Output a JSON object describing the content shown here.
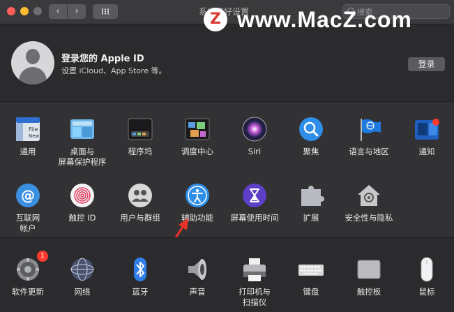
{
  "window": {
    "title": "系统偏好设置",
    "search_placeholder": "搜索"
  },
  "watermark": {
    "logo_letter": "Z",
    "text": "www.MacZ.com"
  },
  "account": {
    "title": "登录您的 Apple ID",
    "subtitle": "设置 iCloud、App Store 等。",
    "signin_label": "登录"
  },
  "personal_row1": [
    {
      "label": "通用",
      "icon": "general-icon"
    },
    {
      "label": "桌面与\n屏幕保护程序",
      "icon": "desktop-screensaver-icon"
    },
    {
      "label": "程序坞",
      "icon": "dock-icon"
    },
    {
      "label": "调度中心",
      "icon": "mission-control-icon"
    },
    {
      "label": "Siri",
      "icon": "siri-icon"
    },
    {
      "label": "聚焦",
      "icon": "spotlight-icon"
    },
    {
      "label": "语言与地区",
      "icon": "language-region-icon"
    },
    {
      "label": "通知",
      "icon": "notifications-icon"
    }
  ],
  "personal_row2": [
    {
      "label": "互联网\n帐户",
      "icon": "internet-accounts-icon"
    },
    {
      "label": "触控 ID",
      "icon": "touch-id-icon"
    },
    {
      "label": "用户与群组",
      "icon": "users-groups-icon"
    },
    {
      "label": "辅助功能",
      "icon": "accessibility-icon"
    },
    {
      "label": "屏幕使用时间",
      "icon": "screen-time-icon"
    },
    {
      "label": "扩展",
      "icon": "extensions-icon"
    },
    {
      "label": "安全性与隐私",
      "icon": "security-privacy-icon"
    }
  ],
  "hardware_row": [
    {
      "label": "软件更新",
      "icon": "software-update-icon",
      "badge": "1"
    },
    {
      "label": "网络",
      "icon": "network-icon"
    },
    {
      "label": "蓝牙",
      "icon": "bluetooth-icon"
    },
    {
      "label": "声音",
      "icon": "sound-icon"
    },
    {
      "label": "打印机与\n扫描仪",
      "icon": "printers-scanners-icon"
    },
    {
      "label": "键盘",
      "icon": "keyboard-icon"
    },
    {
      "label": "触控板",
      "icon": "trackpad-icon"
    },
    {
      "label": "鼠标",
      "icon": "mouse-icon"
    }
  ],
  "colors": {
    "accent_red": "#ff3b30",
    "annotation_arrow": "#e8352b"
  }
}
